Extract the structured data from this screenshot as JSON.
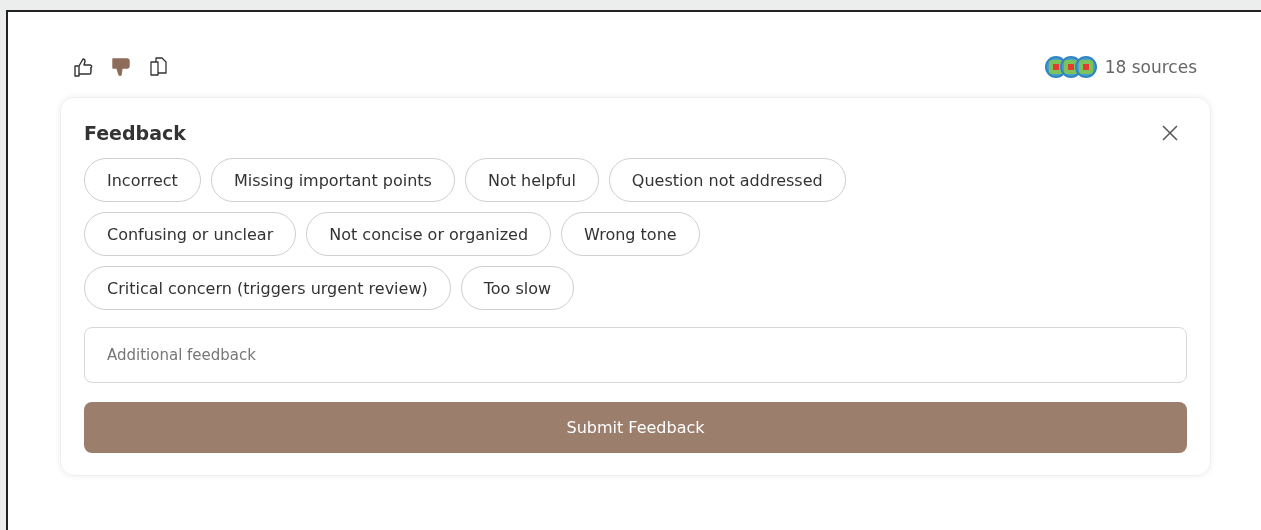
{
  "ratings": [
    {
      "kind": "thumbs_up",
      "selected": false
    },
    {
      "kind": "thumbs_down",
      "selected": true
    },
    {
      "kind": "copy",
      "selected": false
    }
  ],
  "sources": {
    "label": "18 sources"
  },
  "feedback": {
    "title": "Feedback",
    "chips": [
      {
        "label": "Incorrect",
        "selected": false
      },
      {
        "label": "Missing important points",
        "selected": false
      },
      {
        "label": "Not helpful",
        "selected": false
      },
      {
        "label": "Question not addressed",
        "selected": false
      },
      {
        "label": "Confusing or unclear",
        "selected": false
      },
      {
        "label": "Not concise or organized",
        "selected": false
      },
      {
        "label": "Wrong tone",
        "selected": false
      },
      {
        "label": "Critical concern (triggers urgent review)",
        "selected": false
      },
      {
        "label": "Too slow",
        "selected": false
      }
    ],
    "input": {
      "placeholder": "Additional feedback"
    },
    "submit": "Submit Feedback"
  }
}
